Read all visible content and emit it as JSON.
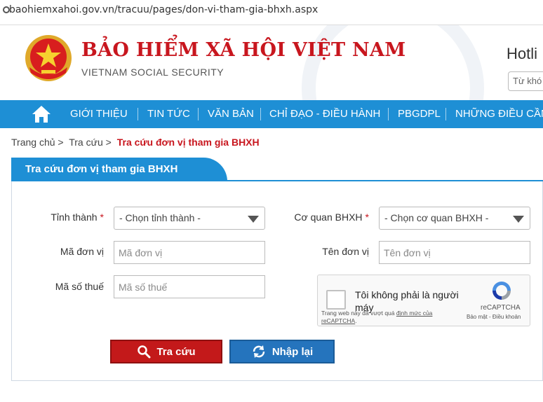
{
  "browser": {
    "url": "baohiemxahoi.gov.vn/tracuu/pages/don-vi-tham-gia-bhxh.aspx"
  },
  "header": {
    "title": "BẢO HIỂM XÃ HỘI VIỆT NAM",
    "subtitle": "VIETNAM SOCIAL SECURITY",
    "hotline": "Hotli",
    "search_placeholder": "Từ khó"
  },
  "nav": {
    "items": [
      "GIỚI THIỆU",
      "TIN TỨC",
      "VĂN BẢN",
      "CHỈ ĐẠO - ĐIỀU HÀNH",
      "PBGDPL",
      "NHỮNG ĐIỀU CẦN"
    ]
  },
  "breadcrumb": {
    "home": "Trang chủ >",
    "lookup": "Tra cứu >",
    "current": "Tra cứu đơn vị tham gia BHXH"
  },
  "panel": {
    "title": "Tra cứu đơn vị tham gia BHXH"
  },
  "form": {
    "province_label": "Tỉnh thành",
    "province_value": "- Chọn tỉnh thành -",
    "agency_label": "Cơ quan BHXH",
    "agency_value": "- Chọn cơ quan BHXH -",
    "unit_code_label": "Mã đơn vị",
    "unit_code_placeholder": "Mã đơn vị",
    "unit_name_label": "Tên đơn vị",
    "unit_name_placeholder": "Tên đơn vị",
    "tax_code_label": "Mã số thuế",
    "tax_code_placeholder": "Mã số thuế",
    "required_mark": "*"
  },
  "captcha": {
    "text": "Tôi không phải là người máy",
    "brand": "reCAPTCHA",
    "terms": "Bảo mật - Điều khoản",
    "note": "Trang web này đã vượt quá",
    "note_link": "định mức của reCAPTCHA",
    "note_end": "."
  },
  "buttons": {
    "search": "Tra cứu",
    "reset": "Nhập lại"
  },
  "colors": {
    "brand_red": "#c8161e",
    "nav_blue": "#1e8fd5",
    "btn_red": "#c3191a",
    "btn_blue": "#2574bd"
  }
}
